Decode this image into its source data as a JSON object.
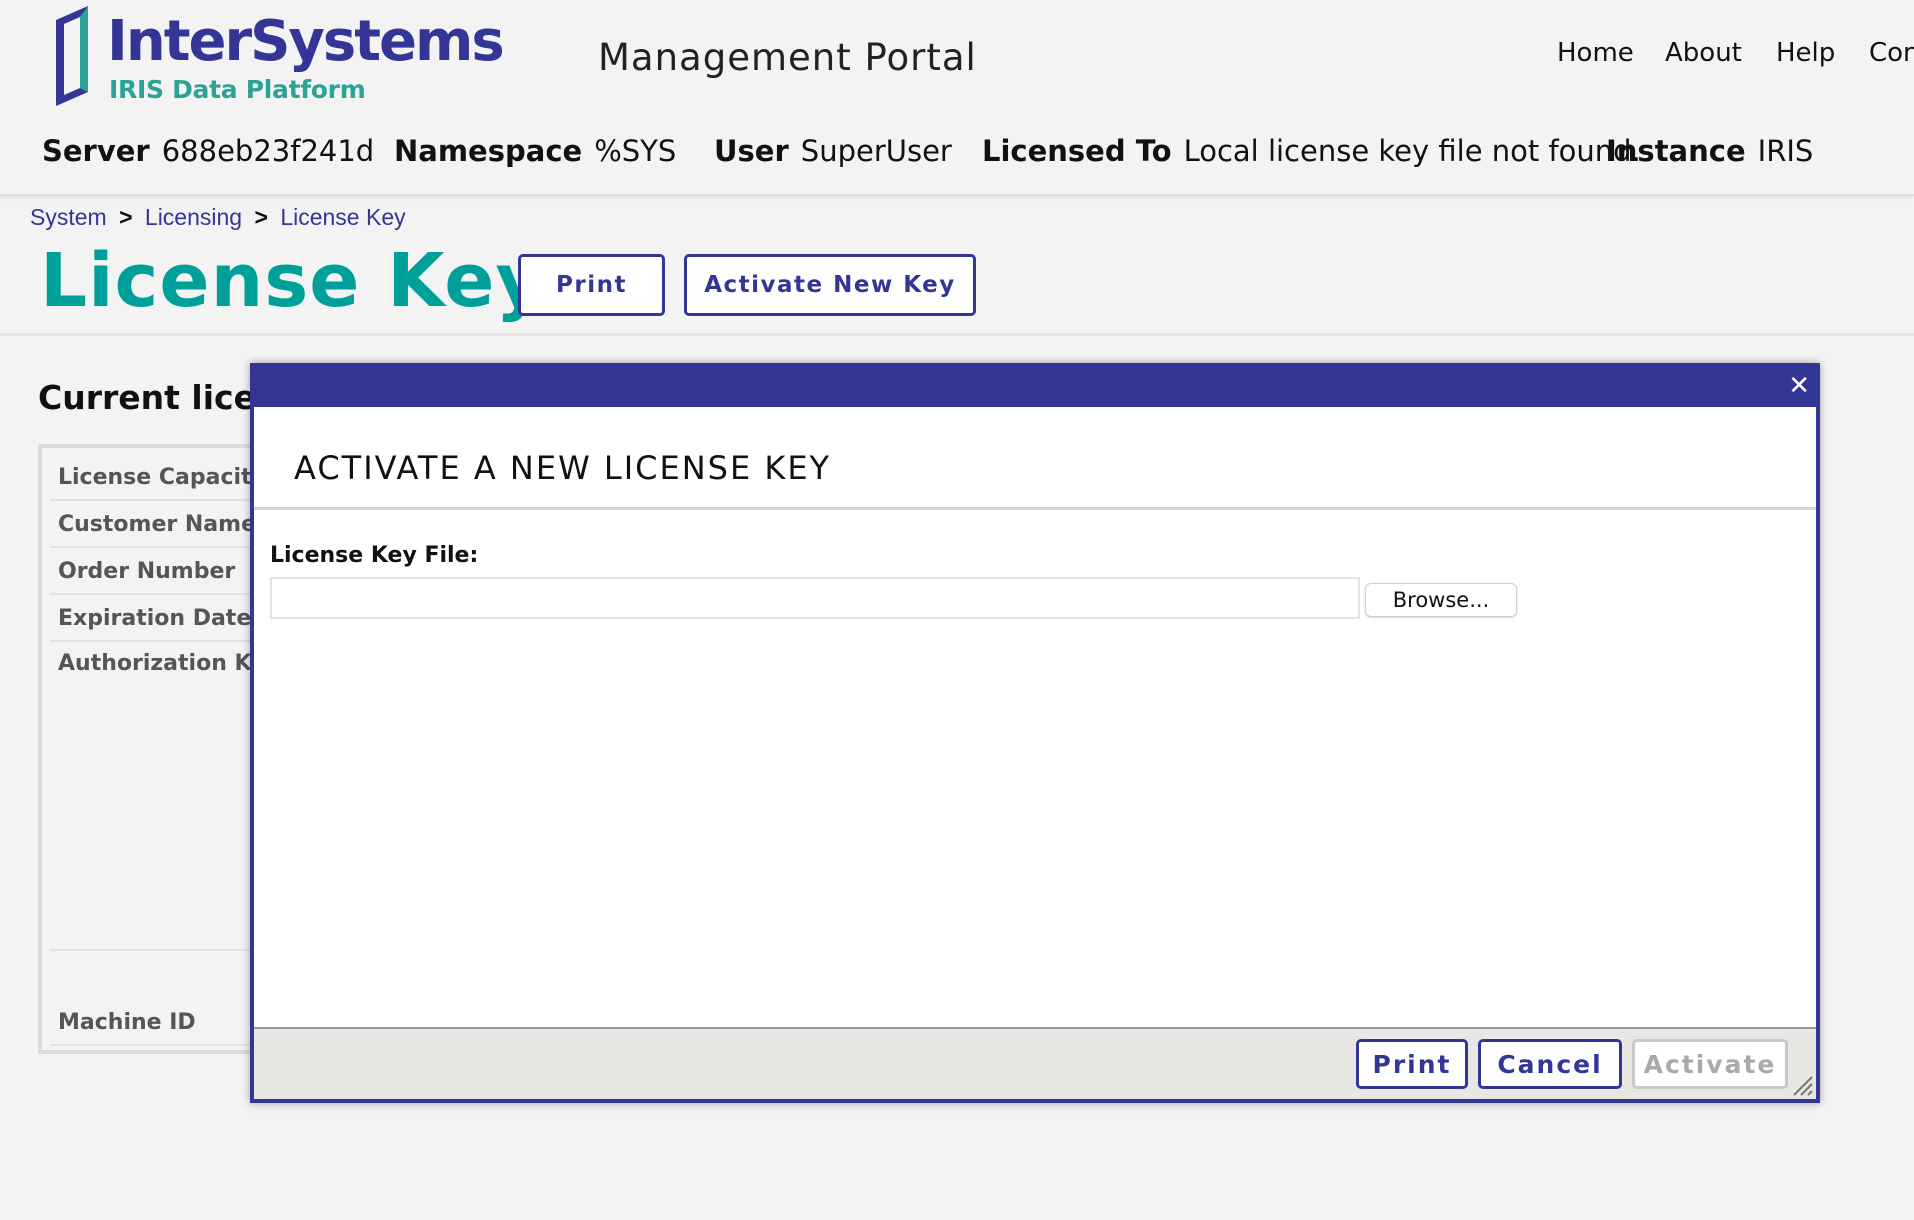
{
  "header": {
    "logo_word": "InterSystems",
    "logo_tm": "™",
    "logo_sub": "IRIS Data Platform",
    "portal_title": "Management Portal",
    "nav": [
      "Home",
      "About",
      "Help",
      "Con"
    ],
    "info": {
      "server_label": "Server",
      "server": "688eb23f241d",
      "namespace_label": "Namespace",
      "namespace": "%SYS",
      "user_label": "User",
      "user": "SuperUser",
      "licensed_label": "Licensed To",
      "licensed": "Local license key file not found.",
      "instance_label": "Instance",
      "instance": "IRIS"
    }
  },
  "breadcrumb": [
    "System",
    "Licensing",
    "License Key"
  ],
  "breadcrumb_sep": ">",
  "page": {
    "title": "License Key",
    "print_label": "Print",
    "activate_label": "Activate New Key",
    "section_heading": "Current license",
    "rows": [
      "License Capacity",
      "Customer Name",
      "Order Number",
      "Expiration Date",
      "Authorization Key",
      "Machine ID"
    ]
  },
  "dialog": {
    "close_glyph": "✕",
    "heading": "ACTIVATE A NEW LICENSE KEY",
    "field_label": "License Key File:",
    "file_value": "",
    "browse_label": "Browse...",
    "buttons": {
      "print": "Print",
      "cancel": "Cancel",
      "activate": "Activate"
    }
  },
  "colors": {
    "brand_navy": "#333695",
    "brand_teal": "#00a09a",
    "logo_teal": "#2ca397",
    "disabled": "#a9a9a9"
  },
  "icons": {
    "close": "close-icon",
    "resize": "resize-grip-icon",
    "logo": "intersystems-logo-icon"
  }
}
